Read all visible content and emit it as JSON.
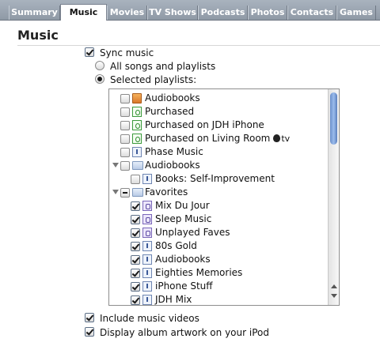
{
  "tabs": [
    "Summary",
    "Music",
    "Movies",
    "TV Shows",
    "Podcasts",
    "Photos",
    "Contacts",
    "Games"
  ],
  "active_tab": "Music",
  "section_title": "Music",
  "sync_music": {
    "label": "Sync music",
    "checked": true
  },
  "sync_options": [
    {
      "label": "All songs and playlists",
      "selected": false
    },
    {
      "label": "Selected playlists:",
      "selected": true
    }
  ],
  "playlists": [
    {
      "name": "Audiobooks",
      "checked": false,
      "icon": "audiobooks-icon",
      "indent": 0
    },
    {
      "name": "Purchased",
      "checked": false,
      "icon": "purchased-playlist-icon",
      "indent": 0
    },
    {
      "name": "Purchased on JDH iPhone",
      "checked": false,
      "icon": "purchased-playlist-icon",
      "indent": 0
    },
    {
      "name": "Purchased on Living Room",
      "checked": false,
      "icon": "purchased-playlist-icon",
      "indent": 0,
      "suffix": "tv"
    },
    {
      "name": "Phase Music",
      "checked": false,
      "icon": "music-playlist-icon",
      "indent": 0
    },
    {
      "name": "Audiobooks",
      "checked": false,
      "icon": "folder-icon",
      "indent": 0,
      "expanded": true
    },
    {
      "name": "Books: Self-Improvement",
      "checked": false,
      "icon": "music-playlist-icon",
      "indent": 1
    },
    {
      "name": "Favorites",
      "checked": "mixed",
      "icon": "folder-icon",
      "indent": 0,
      "expanded": true
    },
    {
      "name": "Mix Du Jour",
      "checked": true,
      "icon": "smart-playlist-icon",
      "indent": 1
    },
    {
      "name": "Sleep Music",
      "checked": true,
      "icon": "smart-playlist-icon",
      "indent": 1
    },
    {
      "name": "Unplayed Faves",
      "checked": true,
      "icon": "smart-playlist-icon",
      "indent": 1
    },
    {
      "name": "80s Gold",
      "checked": true,
      "icon": "music-playlist-icon",
      "indent": 1
    },
    {
      "name": "Audiobooks",
      "checked": true,
      "icon": "music-playlist-icon",
      "indent": 1
    },
    {
      "name": "Eighties Memories",
      "checked": true,
      "icon": "music-playlist-icon",
      "indent": 1
    },
    {
      "name": "iPhone Stuff",
      "checked": true,
      "icon": "music-playlist-icon",
      "indent": 1
    },
    {
      "name": "JDH Mix",
      "checked": true,
      "icon": "music-playlist-icon",
      "indent": 1
    }
  ],
  "bottom_options": [
    {
      "label": "Include music videos",
      "checked": true
    },
    {
      "label": "Display album artwork on your iPod",
      "checked": true
    }
  ]
}
